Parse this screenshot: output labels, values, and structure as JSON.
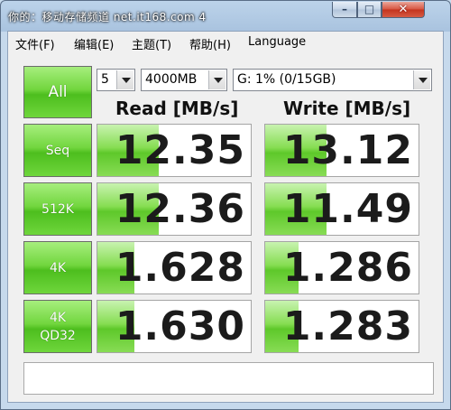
{
  "window": {
    "title": "你的：移动存储频道 net.it168.com 4",
    "buttons": {
      "minimize": "–",
      "maximize": "□",
      "close": "✕"
    }
  },
  "menu": [
    "文件(F)",
    "编辑(E)",
    "主题(T)",
    "帮助(H)",
    "Language"
  ],
  "controls": {
    "all_label": "All",
    "count_value": "5",
    "size_value": "4000MB",
    "drive_value": "G: 1% (0/15GB)"
  },
  "headers": {
    "read": "Read [MB/s]",
    "write": "Write [MB/s]"
  },
  "rows": [
    {
      "label": "Seq",
      "read": "12.35",
      "write": "13.12"
    },
    {
      "label": "512K",
      "read": "12.36",
      "write": "11.49"
    },
    {
      "label": "4K",
      "read": "1.628",
      "write": "1.286"
    },
    {
      "label": "4K\nQD32",
      "label_line1": "4K",
      "label_line2": "QD32",
      "read": "1.630",
      "write": "1.283"
    }
  ],
  "colors": {
    "accent_green": "#5ec82a",
    "button_green": "#4dbe1e",
    "titlebar_blue": "#a9c3df"
  },
  "status_text": ""
}
